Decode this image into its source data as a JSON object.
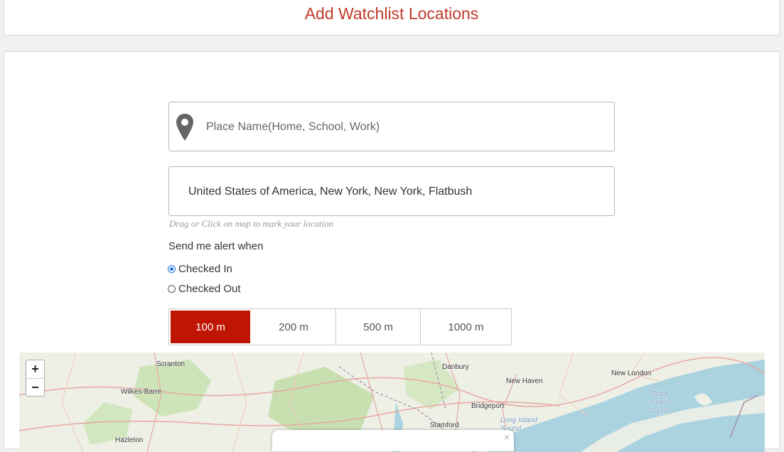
{
  "header": {
    "title": "Add Watchlist Locations"
  },
  "form": {
    "place_placeholder": "Place Name(Home, School, Work)",
    "address_value": "United States of America, New York, New York, Flatbush",
    "hint": "Drag or Click on map to mark your location",
    "alert_label": "Send me alert when",
    "options": [
      {
        "label": "Checked In",
        "checked": true
      },
      {
        "label": "Checked Out",
        "checked": false
      }
    ],
    "distances": [
      {
        "label": "100 m",
        "active": true
      },
      {
        "label": "200 m",
        "active": false
      },
      {
        "label": "500 m",
        "active": false
      },
      {
        "label": "1000 m",
        "active": false
      }
    ]
  },
  "map": {
    "zoom_in": "+",
    "zoom_out": "−",
    "popup_close": "×",
    "labels": [
      "Scranton",
      "Wilkes-Barre",
      "Hazleton",
      "Danbury",
      "New Haven",
      "New London",
      "Bridgeport",
      "Stamford",
      "Long Island Sound",
      "Block Island Sound"
    ]
  },
  "colors": {
    "accent": "#c01405",
    "title": "#c0392b",
    "water": "#aad3df",
    "land": "#eef0e6"
  }
}
